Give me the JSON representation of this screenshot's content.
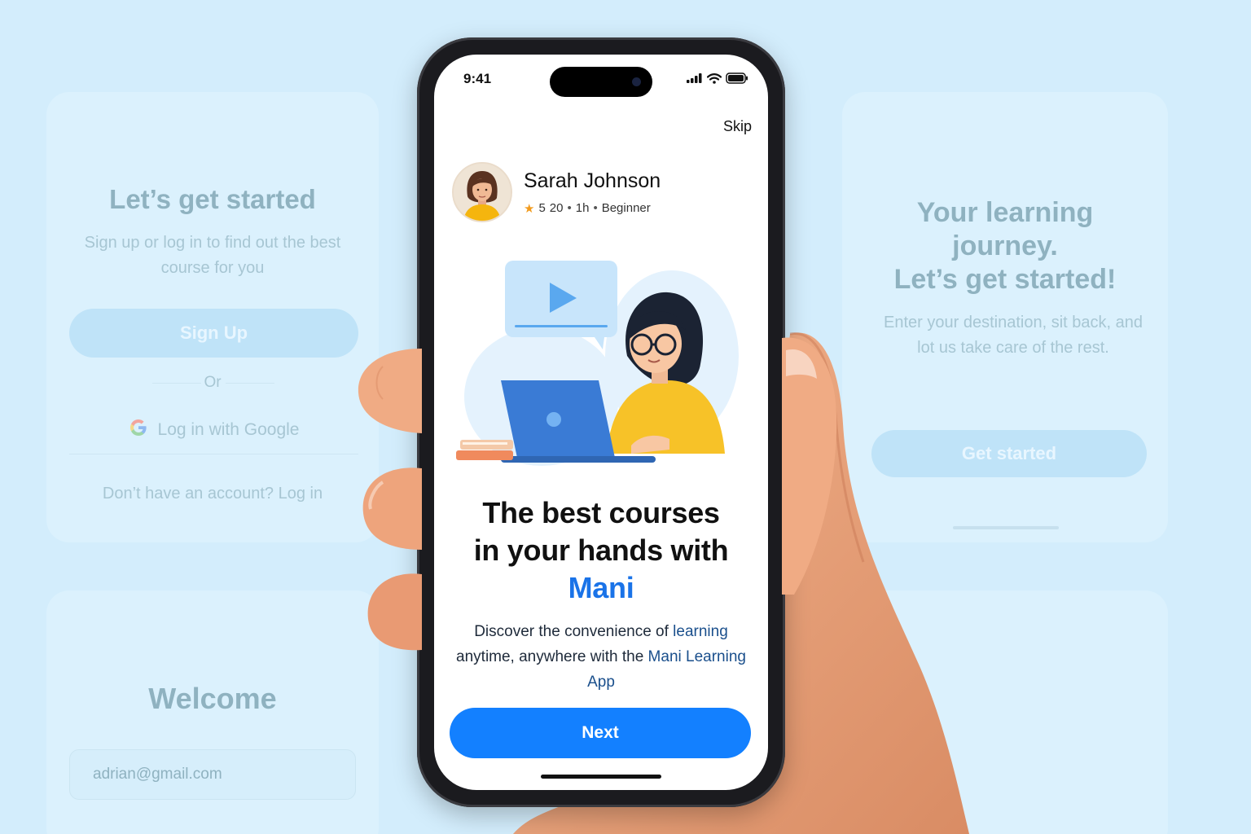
{
  "background": {
    "left_top_card": {
      "title": "Let’s get started",
      "subtitle": "Sign up or log in to find out the best course for you",
      "signup_label": "Sign Up",
      "or_label": "Or",
      "google_label": "Log in with Google",
      "footer_text": "Don’t have an account?  Log in"
    },
    "left_bottom_card": {
      "title": "Welcome",
      "email_value": "adrian@gmail.com"
    },
    "right_top_card": {
      "title_line1": "Your learning",
      "title_line2": "journey.",
      "title_line3": "Let’s get started!",
      "subtitle": "Enter your destination, sit back, and lot us take care of the rest.",
      "button_label": "Get started"
    }
  },
  "phone": {
    "status_bar": {
      "time": "9:41"
    },
    "skip_label": "Skip",
    "profile": {
      "name": "Sarah Johnson",
      "rating": "5",
      "lessons": "20",
      "duration": "1h",
      "level": "Beginner"
    },
    "headline": {
      "line1": "The best courses",
      "line2": "in your hands with",
      "brand": "Mani"
    },
    "description": {
      "part1": "Discover the convenience of ",
      "accent1": "learning",
      "part2": " anytime, anywhere with the ",
      "accent2": "Mani Learning App"
    },
    "next_label": "Next"
  },
  "colors": {
    "background": "#d3edfc",
    "primary": "#1380ff",
    "brand_text": "#1a73e8",
    "star": "#f29b1d"
  },
  "icons": [
    "google-icon",
    "star-icon",
    "signal-icon",
    "wifi-icon",
    "battery-icon",
    "play-icon",
    "laptop-icon"
  ]
}
